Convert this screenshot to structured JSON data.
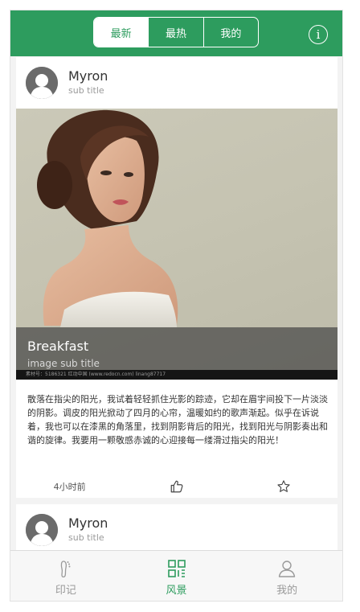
{
  "header": {
    "tabs": [
      {
        "label": "最新",
        "active": true
      },
      {
        "label": "最热",
        "active": false
      },
      {
        "label": "我的",
        "active": false
      }
    ],
    "info_icon": "info-icon"
  },
  "posts": [
    {
      "user": "Myron",
      "sub": "sub title",
      "image_title": "Breakfast",
      "image_sub": "image sub title",
      "watermark": "素材号：5186321    红动中国 (www.redocn.com)    linang87717",
      "text": "散落在指尖的阳光，我试着轻轻抓住光影的踪迹，它却在眉宇间投下一片淡淡的阴影。调皮的阳光掀动了四月的心帘，温暖如约的歌声渐起。似乎在诉说着，我也可以在漆黑的角落里，找到阴影背后的阳光，找到阳光与阴影奏出和谐的旋律。我要用一颗敬感赤诚的心迎接每一缕滑过指尖的阳光！",
      "time": "4小时前"
    },
    {
      "user": "Myron",
      "sub": "sub title"
    }
  ],
  "tabbar": [
    {
      "label": "印记",
      "icon": "footprint-icon",
      "active": false
    },
    {
      "label": "风景",
      "icon": "scan-grid-icon",
      "active": true
    },
    {
      "label": "我的",
      "icon": "person-icon",
      "active": false
    }
  ],
  "colors": {
    "accent": "#2d9c5e",
    "inactive": "#999999"
  }
}
